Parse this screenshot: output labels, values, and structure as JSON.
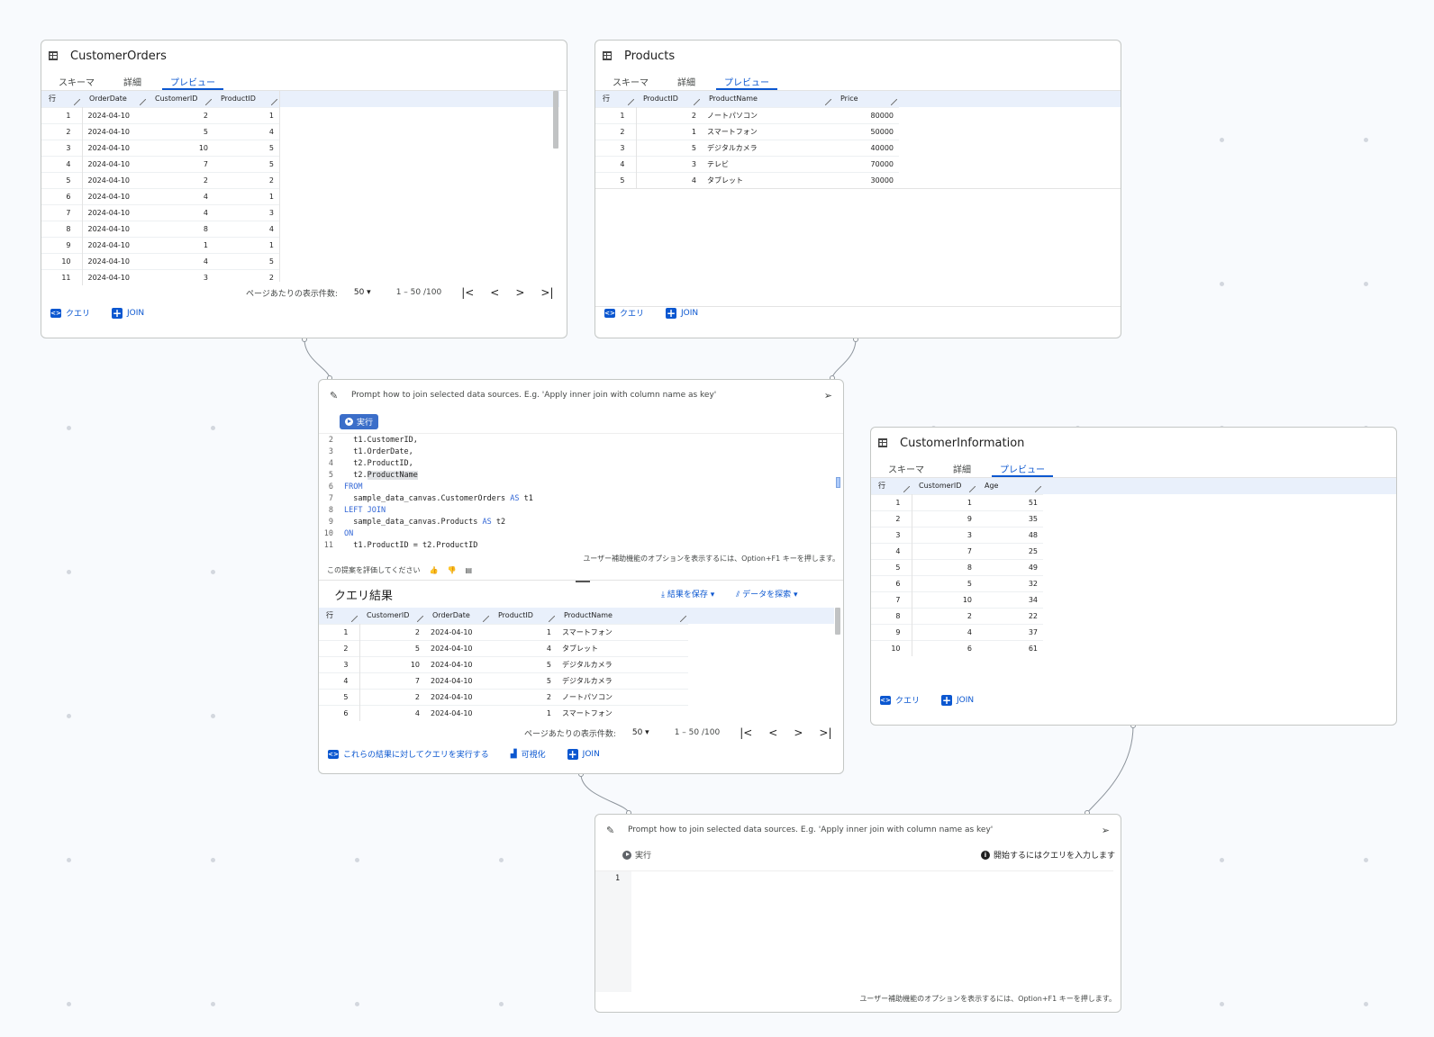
{
  "colors": {
    "accent": "#0b57d0",
    "background": "#f8fafd",
    "header_fill": "#e9f0fb"
  },
  "customer_orders": {
    "title": "CustomerOrders",
    "tabs": [
      "スキーマ",
      "詳細",
      "プレビュー"
    ],
    "columns": [
      "行",
      "OrderDate",
      "CustomerID",
      "ProductID"
    ],
    "rows": [
      [
        "1",
        "2024-04-10",
        "2",
        "1"
      ],
      [
        "2",
        "2024-04-10",
        "5",
        "4"
      ],
      [
        "3",
        "2024-04-10",
        "10",
        "5"
      ],
      [
        "4",
        "2024-04-10",
        "7",
        "5"
      ],
      [
        "5",
        "2024-04-10",
        "2",
        "2"
      ],
      [
        "6",
        "2024-04-10",
        "4",
        "1"
      ],
      [
        "7",
        "2024-04-10",
        "4",
        "3"
      ],
      [
        "8",
        "2024-04-10",
        "8",
        "4"
      ],
      [
        "9",
        "2024-04-10",
        "1",
        "1"
      ],
      [
        "10",
        "2024-04-10",
        "4",
        "5"
      ],
      [
        "11",
        "2024-04-10",
        "3",
        "2"
      ]
    ],
    "pager": {
      "label": "ページあたりの表示件数:",
      "page_size": "50",
      "range": "1 – 50 /100"
    },
    "query_label": "クエリ",
    "join_label": "JOIN"
  },
  "products": {
    "title": "Products",
    "tabs": [
      "スキーマ",
      "詳細",
      "プレビュー"
    ],
    "columns": [
      "行",
      "ProductID",
      "ProductName",
      "Price"
    ],
    "rows": [
      [
        "1",
        "2",
        "ノートパソコン",
        "80000"
      ],
      [
        "2",
        "1",
        "スマートフォン",
        "50000"
      ],
      [
        "3",
        "5",
        "デジタルカメラ",
        "40000"
      ],
      [
        "4",
        "3",
        "テレビ",
        "70000"
      ],
      [
        "5",
        "4",
        "タブレット",
        "30000"
      ]
    ],
    "query_label": "クエリ",
    "join_label": "JOIN"
  },
  "customer_information": {
    "title": "CustomerInformation",
    "tabs": [
      "スキーマ",
      "詳細",
      "プレビュー"
    ],
    "columns": [
      "行",
      "CustomerID",
      "Age"
    ],
    "rows": [
      [
        "1",
        "1",
        "51"
      ],
      [
        "2",
        "9",
        "35"
      ],
      [
        "3",
        "3",
        "48"
      ],
      [
        "4",
        "7",
        "25"
      ],
      [
        "5",
        "8",
        "49"
      ],
      [
        "6",
        "5",
        "32"
      ],
      [
        "7",
        "10",
        "34"
      ],
      [
        "8",
        "2",
        "22"
      ],
      [
        "9",
        "4",
        "37"
      ],
      [
        "10",
        "6",
        "61"
      ]
    ],
    "query_label": "クエリ",
    "join_label": "JOIN"
  },
  "join_node_1": {
    "prompt_placeholder": "Prompt how to join selected data sources. E.g. 'Apply inner join with column name as key'",
    "run_label": "実行",
    "code_lines": [
      {
        "n": "2",
        "t": "  t1.CustomerID,"
      },
      {
        "n": "3",
        "t": "  t1.OrderDate,"
      },
      {
        "n": "4",
        "t": "  t2.ProductID,"
      },
      {
        "n": "5",
        "t": "  t2.ProductName"
      },
      {
        "n": "6",
        "t": "FROM"
      },
      {
        "n": "7",
        "t": "  sample_data_canvas.CustomerOrders AS t1"
      },
      {
        "n": "8",
        "t": "LEFT JOIN"
      },
      {
        "n": "9",
        "t": "  sample_data_canvas.Products AS t2"
      },
      {
        "n": "10",
        "t": "ON"
      },
      {
        "n": "11",
        "t": "  t1.ProductID = t2.ProductID"
      }
    ],
    "a11y_hint": "ユーザー補助機能のオプションを表示するには、Option+F1 キーを押します。",
    "rate_label": "この提案を評価してください",
    "results_title": "クエリ結果",
    "save_label": "結果を保存",
    "explore_label": "データを探索",
    "result_columns": [
      "行",
      "CustomerID",
      "OrderDate",
      "ProductID",
      "ProductName"
    ],
    "result_rows": [
      [
        "1",
        "2",
        "2024-04-10",
        "1",
        "スマートフォン"
      ],
      [
        "2",
        "5",
        "2024-04-10",
        "4",
        "タブレット"
      ],
      [
        "3",
        "10",
        "2024-04-10",
        "5",
        "デジタルカメラ"
      ],
      [
        "4",
        "7",
        "2024-04-10",
        "5",
        "デジタルカメラ"
      ],
      [
        "5",
        "2",
        "2024-04-10",
        "2",
        "ノートパソコン"
      ],
      [
        "6",
        "4",
        "2024-04-10",
        "1",
        "スマートフォン"
      ]
    ],
    "pager": {
      "label": "ページあたりの表示件数:",
      "page_size": "50",
      "range": "1 – 50 /100"
    },
    "run_on_results_label": "これらの結果に対してクエリを実行する",
    "visualize_label": "可視化",
    "join_label": "JOIN"
  },
  "join_node_2": {
    "prompt_placeholder": "Prompt how to join selected data sources. E.g. 'Apply inner join with column name as key'",
    "run_label": "実行",
    "start_hint": "開始するにはクエリを入力します",
    "line_number": "1",
    "a11y_hint": "ユーザー補助機能のオプションを表示するには、Option+F1 キーを押します。"
  }
}
